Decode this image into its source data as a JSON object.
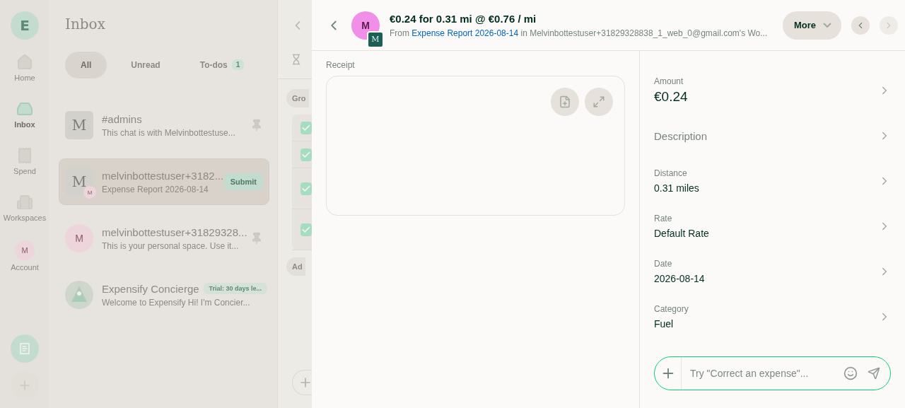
{
  "nav": {
    "logo": "E",
    "items": [
      {
        "label": "Home",
        "selected": false,
        "kind": "home"
      },
      {
        "label": "Inbox",
        "selected": true,
        "kind": "inbox"
      },
      {
        "label": "Spend",
        "selected": false,
        "kind": "spend"
      },
      {
        "label": "Workspaces",
        "selected": false,
        "kind": "workspaces"
      },
      {
        "label": "Account",
        "selected": false,
        "kind": "avatar",
        "initial": "M"
      }
    ]
  },
  "inbox": {
    "title": "Inbox",
    "filters": [
      {
        "label": "All",
        "selected": true
      },
      {
        "label": "Unread",
        "selected": false
      },
      {
        "label": "To-dos",
        "selected": false,
        "count": "1"
      }
    ],
    "chats": [
      {
        "kind": "square",
        "title": "#admins",
        "preview": "This chat is with Melvinbottestuse...",
        "avatar": "M",
        "pinned": true,
        "selected": false
      },
      {
        "kind": "square",
        "title": "melvinbottestuser+3182...",
        "preview": "Expense Report 2026-08-14",
        "avatar": "M",
        "sub_avatar": "M",
        "action": "Submit",
        "pinned": false,
        "selected": true
      },
      {
        "kind": "circle",
        "title": "melvinbottestuser+31829328...",
        "preview": "This is your personal space. Use it...",
        "avatar": "M",
        "pinned": true,
        "selected": false
      },
      {
        "kind": "concierge",
        "title": "Expensify Concierge",
        "badge": "Trial: 30 days le...",
        "preview": "Welcome to Expensify Hi! I'm Concier...",
        "pinned": false,
        "selected": false
      }
    ]
  },
  "report_pane": {
    "group_button": "Gro",
    "rows": [
      {
        "checked": true
      },
      {
        "checked": true
      },
      {
        "checked": true
      },
      {
        "checked": true
      }
    ],
    "add_button": "Ad"
  },
  "expense": {
    "title": "€0.24 for 0.31 mi @ €0.76 / mi",
    "avatar": "M",
    "sub_avatar": "M",
    "from_label": "From",
    "report_link": "Expense Report 2026-08-14",
    "in_label": "in",
    "workspace": "Melvinbottestuser+31829328838_1_web_0@gmail.com's Wo...",
    "more_button": "More",
    "prev_disabled": false,
    "next_disabled": true,
    "receipt_label": "Receipt",
    "fields": [
      {
        "kind": "amount",
        "label": "Amount",
        "value": "€0.24"
      },
      {
        "kind": "empty",
        "label": "Description"
      },
      {
        "kind": "text",
        "label": "Distance",
        "value": "0.31 miles"
      },
      {
        "kind": "text",
        "label": "Rate",
        "value": "Default Rate"
      },
      {
        "kind": "text",
        "label": "Date",
        "value": "2026-08-14"
      },
      {
        "kind": "text",
        "label": "Category",
        "value": "Fuel"
      }
    ],
    "composer": {
      "placeholder": "Try \"Correct an expense\"..."
    }
  }
}
